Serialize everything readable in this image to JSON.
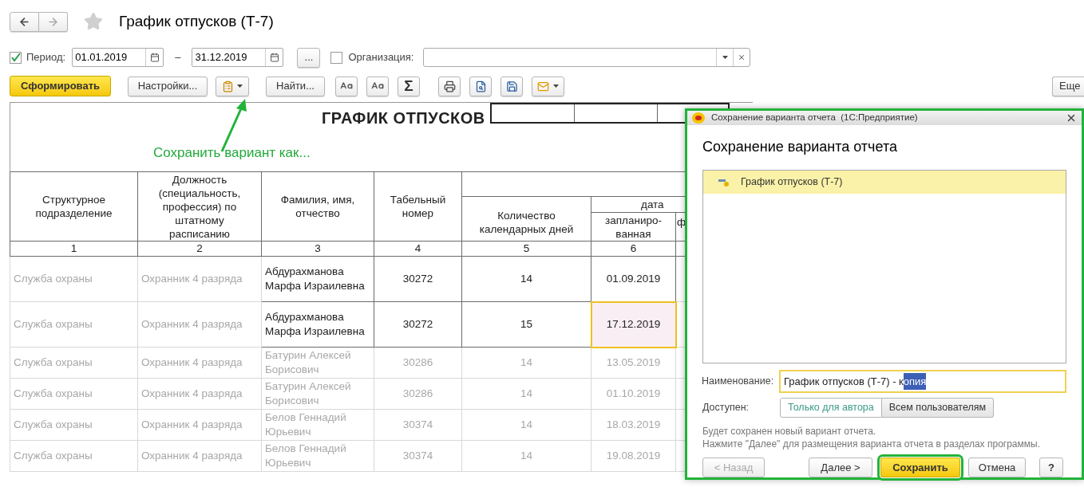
{
  "title": "График отпусков (Т-7)",
  "favorite": false,
  "filters": {
    "period": {
      "checked": true,
      "label": "Период:",
      "from": "01.01.2019",
      "separator": "–",
      "to": "31.12.2019",
      "more_button": "..."
    },
    "organization": {
      "checked": false,
      "label": "Организация:"
    }
  },
  "toolbar": {
    "generate_button": "Сформировать",
    "settings_button": "Настройки...",
    "find_button": "Найти...",
    "sum_button": "Σ",
    "more_button": "Еще"
  },
  "report": {
    "title": "ГРАФИК ОТПУСКОВ",
    "columns": [
      "Структурное подразделение",
      "Должность (специальность, профессия) по штатному расписанию",
      "Фамилия, имя, отчество",
      "Табельный номер",
      "Количество календарных дней",
      "запланиро-ванная",
      "ф"
    ],
    "group_label": "дата",
    "column_numbers": [
      "1",
      "2",
      "3",
      "4",
      "5",
      "6"
    ],
    "rows": [
      {
        "kind": "partly_blurred",
        "date_selected": false,
        "cells": [
          "Служба охраны",
          "Охранник 4 разряда",
          "Абдурахманова Марфа Израилевна",
          "30272",
          "14",
          "01.09.2019"
        ]
      },
      {
        "kind": "partly_blurred",
        "date_selected": true,
        "cells": [
          "Служба охраны",
          "Охранник 4 разряда",
          "Абдурахманова Марфа Израилевна",
          "30272",
          "15",
          "17.12.2019"
        ]
      },
      {
        "kind": "blurred",
        "date_selected": false,
        "cells": [
          "Служба охраны",
          "Охранник 4 разряда",
          "Батурин Алексей Борисович",
          "30286",
          "14",
          "13.05.2019"
        ]
      },
      {
        "kind": "blurred",
        "date_selected": false,
        "cells": [
          "Служба охраны",
          "Охранник 4 разряда",
          "Батурин Алексей Борисович",
          "30286",
          "14",
          "01.10.2019"
        ]
      },
      {
        "kind": "blurred",
        "date_selected": false,
        "cells": [
          "Служба охраны",
          "Охранник 4 разряда",
          "Белов Геннадий Юрьевич",
          "30374",
          "14",
          "18.03.2019"
        ]
      },
      {
        "kind": "blurred",
        "date_selected": false,
        "cells": [
          "Служба охраны",
          "Охранник 4 разряда",
          "Белов Геннадий Юрьевич",
          "30374",
          "14",
          "19.08.2019"
        ]
      }
    ]
  },
  "annotation": {
    "text": "Сохранить вариант как..."
  },
  "dialog": {
    "highlighted": true,
    "window_title": "Сохранение варианта отчета  (1С:Предприятие)",
    "heading": "Сохранение варианта отчета",
    "variants": [
      {
        "label": "График отпусков (Т-7)",
        "selected": true
      }
    ],
    "name_label": "Наименование:",
    "name_value": [
      {
        "text": "График отпусков (Т-7) - к",
        "selected": false
      },
      {
        "text": "опия",
        "selected": true
      }
    ],
    "access_label": "Доступен:",
    "access_options": [
      {
        "label": "Только для автора",
        "selected": true
      },
      {
        "label": "Всем пользователям",
        "selected": false
      }
    ],
    "info": [
      "Будет сохранен новый вариант отчета.",
      "Нажмите \"Далее\" для размещения варианта отчета в разделах программы."
    ],
    "buttons": [
      {
        "kind": "back",
        "label": "< Назад",
        "disabled": true,
        "highlighted": false
      },
      {
        "kind": "next",
        "label": "Далее >",
        "disabled": false,
        "highlighted": false
      },
      {
        "kind": "default",
        "label": "Сохранить",
        "disabled": false,
        "highlighted": true
      },
      {
        "kind": "cancel",
        "label": "Отмена",
        "disabled": false,
        "highlighted": false
      },
      {
        "kind": "help",
        "label": "?",
        "disabled": false,
        "highlighted": false
      }
    ]
  }
}
